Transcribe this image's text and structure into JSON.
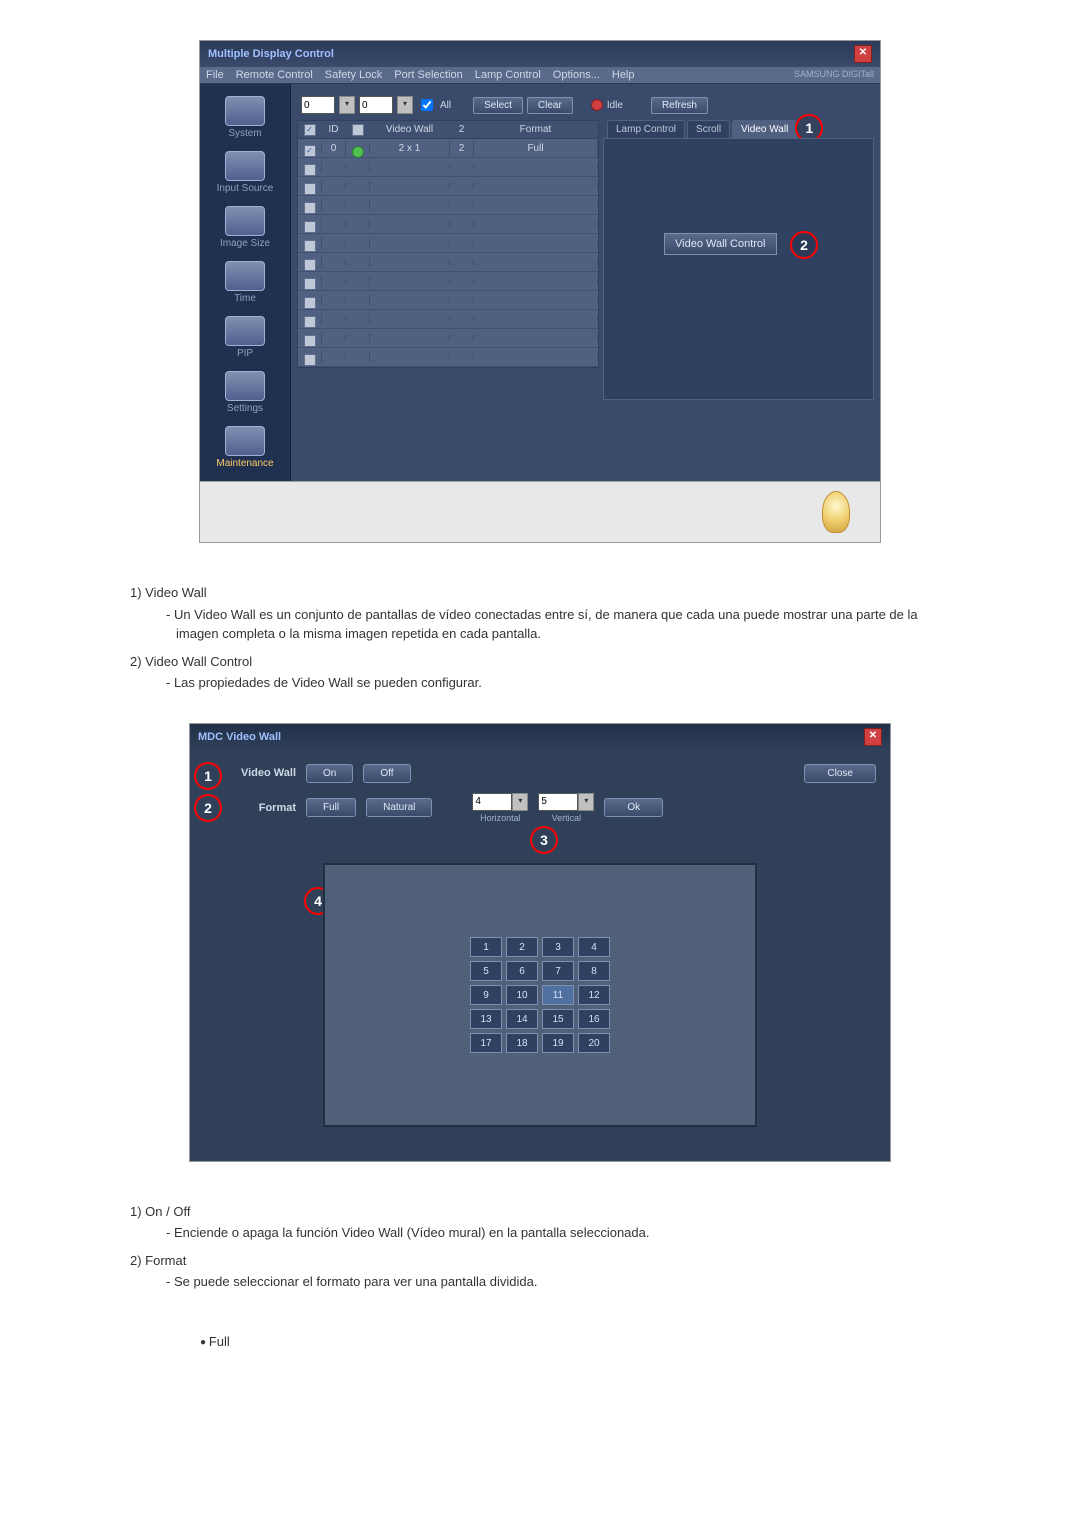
{
  "app": {
    "title": "Multiple Display Control",
    "brand": "SAMSUNG DIGITall",
    "menus": [
      "File",
      "Remote Control",
      "Safety Lock",
      "Port Selection",
      "Lamp Control",
      "Options...",
      "Help"
    ],
    "sidebar": [
      {
        "label": "System"
      },
      {
        "label": "Input Source"
      },
      {
        "label": "Image Size"
      },
      {
        "label": "Time"
      },
      {
        "label": "PIP"
      },
      {
        "label": "Settings"
      },
      {
        "label": "Maintenance"
      }
    ],
    "toolbar": {
      "spin1": "0",
      "spin2": "0",
      "all": "All",
      "select": "Select",
      "clear": "Clear",
      "idle": "Idle",
      "refresh": "Refresh"
    },
    "gridHead": {
      "id": "ID",
      "vw": "Video Wall",
      "two": "2",
      "fmt": "Format"
    },
    "gridRows": [
      {
        "checked": true,
        "id": "0",
        "led": "green",
        "vw": "2 x 1",
        "two": "2",
        "fmt": "Full"
      },
      {
        "checked": false
      },
      {
        "checked": false
      },
      {
        "checked": false
      },
      {
        "checked": false
      },
      {
        "checked": false
      },
      {
        "checked": false
      },
      {
        "checked": false
      },
      {
        "checked": false
      },
      {
        "checked": false
      },
      {
        "checked": false
      },
      {
        "checked": false
      }
    ],
    "tabs": [
      "Lamp Control",
      "Scroll",
      "Video Wall"
    ],
    "vwControlBtn": "Video Wall Control"
  },
  "desc1": {
    "t1": "1)  Video Wall",
    "s1": "- Un Video Wall es un conjunto de pantallas de vídeo conectadas entre sí, de manera que cada una puede mostrar una parte de la imagen completa o la misma imagen repetida en cada pantalla.",
    "t2": "2)  Video Wall Control",
    "s2": "- Las propiedades de Video Wall se pueden configurar."
  },
  "dialog": {
    "title": "MDC Video Wall",
    "vwLabel": "Video Wall",
    "on": "On",
    "off": "Off",
    "fmtLabel": "Format",
    "full": "Full",
    "natural": "Natural",
    "close": "Close",
    "h": "4",
    "v": "5",
    "hLabel": "Horizontal",
    "vLabel": "Vertical",
    "ok": "Ok",
    "tiles": [
      "1",
      "2",
      "3",
      "4",
      "5",
      "6",
      "7",
      "8",
      "9",
      "10",
      "11",
      "12",
      "13",
      "14",
      "15",
      "16",
      "17",
      "18",
      "19",
      "20"
    ],
    "selectedTile": 10
  },
  "desc2": {
    "t1": "1)  On / Off",
    "s1": "- Enciende o apaga la función Video Wall (Vídeo mural) en la pantalla seleccionada.",
    "t2": "2)  Format",
    "s2": "- Se puede seleccionar el formato para ver una pantalla dividida.",
    "bullet": "Full"
  }
}
